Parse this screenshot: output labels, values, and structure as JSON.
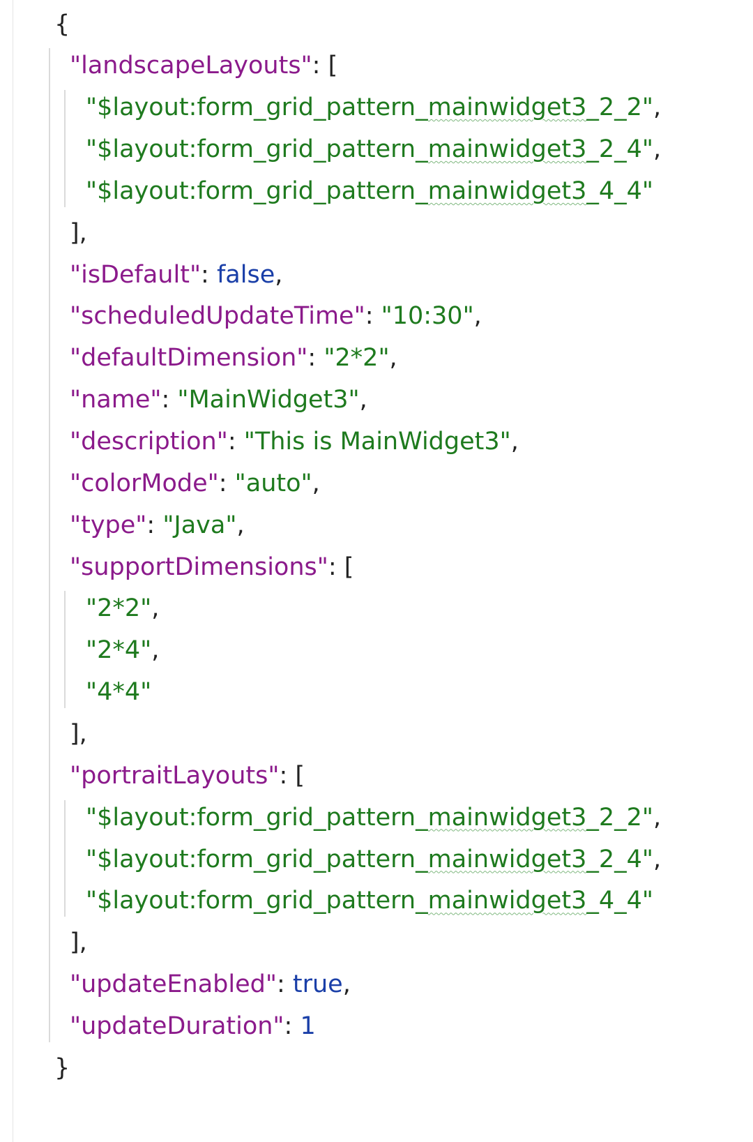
{
  "colors": {
    "key": "#8B1A8B",
    "string": "#1E7A1E",
    "literal": "#1A3FA8",
    "punctuation": "#222222",
    "background": "#FFFFFF",
    "indent_guide": "#DADADA"
  },
  "lines": [
    {
      "indent": 0,
      "tokens": [
        {
          "t": "p",
          "v": "{"
        }
      ]
    },
    {
      "indent": 1,
      "tokens": [
        {
          "t": "key",
          "v": "\"landscapeLayouts\""
        },
        {
          "t": "p",
          "v": ": ["
        }
      ]
    },
    {
      "indent": 2,
      "tokens": [
        {
          "t": "str",
          "v": "\"$layout:form_grid_pattern_"
        },
        {
          "t": "str",
          "v": "mainwidget3",
          "sq": true
        },
        {
          "t": "str",
          "v": "_2_2\""
        },
        {
          "t": "p",
          "v": ","
        }
      ]
    },
    {
      "indent": 2,
      "tokens": [
        {
          "t": "str",
          "v": "\"$layout:form_grid_pattern_"
        },
        {
          "t": "str",
          "v": "mainwidget3",
          "sq": true
        },
        {
          "t": "str",
          "v": "_2_4\""
        },
        {
          "t": "p",
          "v": ","
        }
      ]
    },
    {
      "indent": 2,
      "tokens": [
        {
          "t": "str",
          "v": "\"$layout:form_grid_pattern_"
        },
        {
          "t": "str",
          "v": "mainwidget3",
          "sq": true
        },
        {
          "t": "str",
          "v": "_4_4\""
        }
      ]
    },
    {
      "indent": 1,
      "tokens": [
        {
          "t": "p",
          "v": "],"
        }
      ]
    },
    {
      "indent": 1,
      "tokens": [
        {
          "t": "key",
          "v": "\"isDefault\""
        },
        {
          "t": "p",
          "v": ": "
        },
        {
          "t": "lit",
          "v": "false"
        },
        {
          "t": "p",
          "v": ","
        }
      ]
    },
    {
      "indent": 1,
      "tokens": [
        {
          "t": "key",
          "v": "\"scheduledUpdateTime\""
        },
        {
          "t": "p",
          "v": ": "
        },
        {
          "t": "str",
          "v": "\"10:30\""
        },
        {
          "t": "p",
          "v": ","
        }
      ]
    },
    {
      "indent": 1,
      "tokens": [
        {
          "t": "key",
          "v": "\"defaultDimension\""
        },
        {
          "t": "p",
          "v": ": "
        },
        {
          "t": "str",
          "v": "\"2*2\""
        },
        {
          "t": "p",
          "v": ","
        }
      ]
    },
    {
      "indent": 1,
      "tokens": [
        {
          "t": "key",
          "v": "\"name\""
        },
        {
          "t": "p",
          "v": ": "
        },
        {
          "t": "str",
          "v": "\"MainWidget3\""
        },
        {
          "t": "p",
          "v": ","
        }
      ]
    },
    {
      "indent": 1,
      "tokens": [
        {
          "t": "key",
          "v": "\"description\""
        },
        {
          "t": "p",
          "v": ": "
        },
        {
          "t": "str",
          "v": "\"This is MainWidget3\""
        },
        {
          "t": "p",
          "v": ","
        }
      ]
    },
    {
      "indent": 1,
      "tokens": [
        {
          "t": "key",
          "v": "\"colorMode\""
        },
        {
          "t": "p",
          "v": ": "
        },
        {
          "t": "str",
          "v": "\"auto\""
        },
        {
          "t": "p",
          "v": ","
        }
      ]
    },
    {
      "indent": 1,
      "tokens": [
        {
          "t": "key",
          "v": "\"type\""
        },
        {
          "t": "p",
          "v": ": "
        },
        {
          "t": "str",
          "v": "\"Java\""
        },
        {
          "t": "p",
          "v": ","
        }
      ]
    },
    {
      "indent": 1,
      "tokens": [
        {
          "t": "key",
          "v": "\"supportDimensions\""
        },
        {
          "t": "p",
          "v": ": ["
        }
      ]
    },
    {
      "indent": 2,
      "tokens": [
        {
          "t": "str",
          "v": "\"2*2\""
        },
        {
          "t": "p",
          "v": ","
        }
      ]
    },
    {
      "indent": 2,
      "tokens": [
        {
          "t": "str",
          "v": "\"2*4\""
        },
        {
          "t": "p",
          "v": ","
        }
      ]
    },
    {
      "indent": 2,
      "tokens": [
        {
          "t": "str",
          "v": "\"4*4\""
        }
      ]
    },
    {
      "indent": 1,
      "tokens": [
        {
          "t": "p",
          "v": "],"
        }
      ]
    },
    {
      "indent": 1,
      "tokens": [
        {
          "t": "key",
          "v": "\"portraitLayouts\""
        },
        {
          "t": "p",
          "v": ": ["
        }
      ]
    },
    {
      "indent": 2,
      "tokens": [
        {
          "t": "str",
          "v": "\"$layout:form_grid_pattern_"
        },
        {
          "t": "str",
          "v": "mainwidget3",
          "sq": true
        },
        {
          "t": "str",
          "v": "_2_2\""
        },
        {
          "t": "p",
          "v": ","
        }
      ]
    },
    {
      "indent": 2,
      "tokens": [
        {
          "t": "str",
          "v": "\"$layout:form_grid_pattern_"
        },
        {
          "t": "str",
          "v": "mainwidget3",
          "sq": true
        },
        {
          "t": "str",
          "v": "_2_4\""
        },
        {
          "t": "p",
          "v": ","
        }
      ]
    },
    {
      "indent": 2,
      "tokens": [
        {
          "t": "str",
          "v": "\"$layout:form_grid_pattern_"
        },
        {
          "t": "str",
          "v": "mainwidget3",
          "sq": true
        },
        {
          "t": "str",
          "v": "_4_4\""
        }
      ]
    },
    {
      "indent": 1,
      "tokens": [
        {
          "t": "p",
          "v": "],"
        }
      ]
    },
    {
      "indent": 1,
      "tokens": [
        {
          "t": "key",
          "v": "\"updateEnabled\""
        },
        {
          "t": "p",
          "v": ": "
        },
        {
          "t": "lit",
          "v": "true"
        },
        {
          "t": "p",
          "v": ","
        }
      ]
    },
    {
      "indent": 1,
      "tokens": [
        {
          "t": "key",
          "v": "\"updateDuration\""
        },
        {
          "t": "p",
          "v": ": "
        },
        {
          "t": "lit",
          "v": "1"
        }
      ]
    },
    {
      "indent": 0,
      "tokens": [
        {
          "t": "p",
          "v": "}"
        }
      ]
    }
  ]
}
